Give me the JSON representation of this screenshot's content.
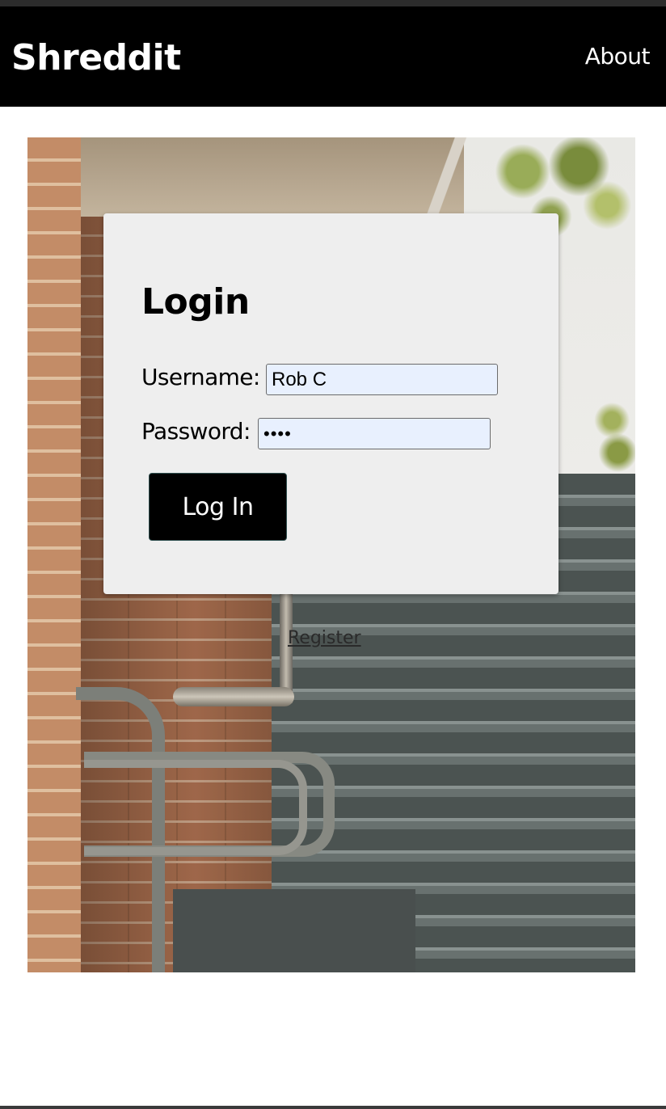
{
  "navbar": {
    "brand": "Shreddit",
    "about": "About"
  },
  "login": {
    "title": "Login",
    "username_label": "Username:",
    "username_value": "Rob C",
    "password_label": "Password:",
    "password_value": "••••",
    "submit_label": "Log In"
  },
  "register": {
    "label": "Register"
  },
  "colors": {
    "navbar_bg": "#000000",
    "card_bg": "#eeeeee",
    "button_bg": "#000000",
    "input_autofill_bg": "#e8f0fe"
  }
}
